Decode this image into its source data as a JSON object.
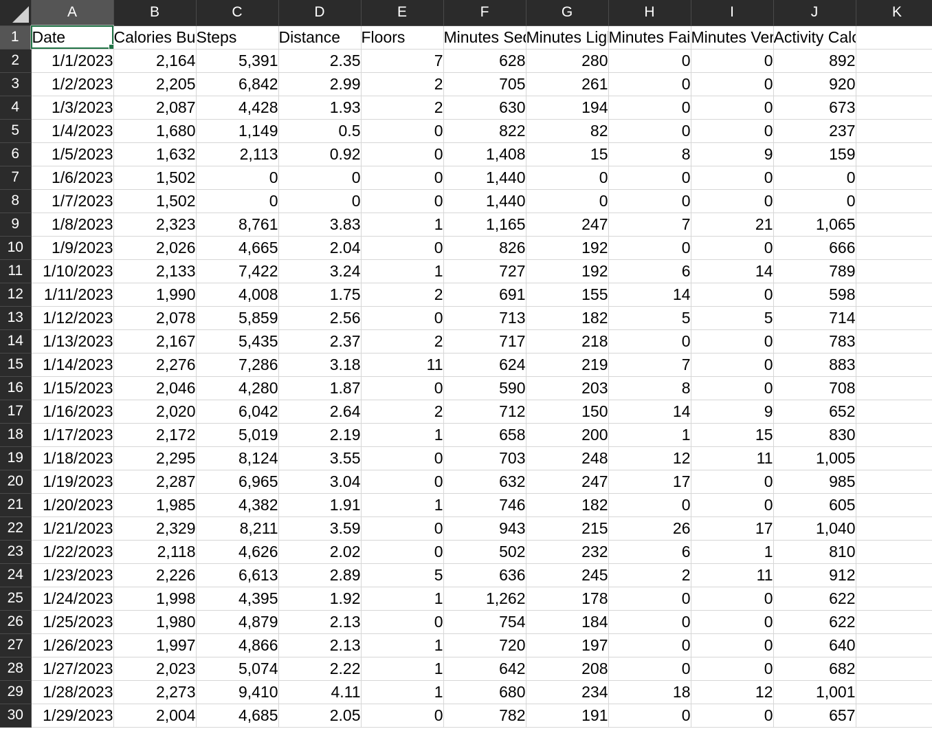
{
  "columns": [
    "A",
    "B",
    "C",
    "D",
    "E",
    "F",
    "G",
    "H",
    "I",
    "J",
    "K"
  ],
  "selected_column": "A",
  "selected_row": "1",
  "headers": [
    "Date",
    "Calories Burned",
    "Steps",
    "Distance",
    "Floors",
    "Minutes Sedentary",
    "Minutes Lightly Active",
    "Minutes Fairly Active",
    "Minutes Very Active",
    "Activity Calories",
    ""
  ],
  "rows": [
    {
      "n": "1",
      "cells": [
        "Date",
        "Calories Burned",
        "Steps",
        "Distance",
        "Floors",
        "Minutes Sedentary",
        "Minutes Lightly Active",
        "Minutes Fairly Active",
        "Minutes Very Active",
        "Activity Calories",
        ""
      ]
    },
    {
      "n": "2",
      "cells": [
        "1/1/2023",
        "2,164",
        "5,391",
        "2.35",
        "7",
        "628",
        "280",
        "0",
        "0",
        "892",
        ""
      ]
    },
    {
      "n": "3",
      "cells": [
        "1/2/2023",
        "2,205",
        "6,842",
        "2.99",
        "2",
        "705",
        "261",
        "0",
        "0",
        "920",
        ""
      ]
    },
    {
      "n": "4",
      "cells": [
        "1/3/2023",
        "2,087",
        "4,428",
        "1.93",
        "2",
        "630",
        "194",
        "0",
        "0",
        "673",
        ""
      ]
    },
    {
      "n": "5",
      "cells": [
        "1/4/2023",
        "1,680",
        "1,149",
        "0.5",
        "0",
        "822",
        "82",
        "0",
        "0",
        "237",
        ""
      ]
    },
    {
      "n": "6",
      "cells": [
        "1/5/2023",
        "1,632",
        "2,113",
        "0.92",
        "0",
        "1,408",
        "15",
        "8",
        "9",
        "159",
        ""
      ]
    },
    {
      "n": "7",
      "cells": [
        "1/6/2023",
        "1,502",
        "0",
        "0",
        "0",
        "1,440",
        "0",
        "0",
        "0",
        "0",
        ""
      ]
    },
    {
      "n": "8",
      "cells": [
        "1/7/2023",
        "1,502",
        "0",
        "0",
        "0",
        "1,440",
        "0",
        "0",
        "0",
        "0",
        ""
      ]
    },
    {
      "n": "9",
      "cells": [
        "1/8/2023",
        "2,323",
        "8,761",
        "3.83",
        "1",
        "1,165",
        "247",
        "7",
        "21",
        "1,065",
        ""
      ]
    },
    {
      "n": "10",
      "cells": [
        "1/9/2023",
        "2,026",
        "4,665",
        "2.04",
        "0",
        "826",
        "192",
        "0",
        "0",
        "666",
        ""
      ]
    },
    {
      "n": "11",
      "cells": [
        "1/10/2023",
        "2,133",
        "7,422",
        "3.24",
        "1",
        "727",
        "192",
        "6",
        "14",
        "789",
        ""
      ]
    },
    {
      "n": "12",
      "cells": [
        "1/11/2023",
        "1,990",
        "4,008",
        "1.75",
        "2",
        "691",
        "155",
        "14",
        "0",
        "598",
        ""
      ]
    },
    {
      "n": "13",
      "cells": [
        "1/12/2023",
        "2,078",
        "5,859",
        "2.56",
        "0",
        "713",
        "182",
        "5",
        "5",
        "714",
        ""
      ]
    },
    {
      "n": "14",
      "cells": [
        "1/13/2023",
        "2,167",
        "5,435",
        "2.37",
        "2",
        "717",
        "218",
        "0",
        "0",
        "783",
        ""
      ]
    },
    {
      "n": "15",
      "cells": [
        "1/14/2023",
        "2,276",
        "7,286",
        "3.18",
        "11",
        "624",
        "219",
        "7",
        "0",
        "883",
        ""
      ]
    },
    {
      "n": "16",
      "cells": [
        "1/15/2023",
        "2,046",
        "4,280",
        "1.87",
        "0",
        "590",
        "203",
        "8",
        "0",
        "708",
        ""
      ]
    },
    {
      "n": "17",
      "cells": [
        "1/16/2023",
        "2,020",
        "6,042",
        "2.64",
        "2",
        "712",
        "150",
        "14",
        "9",
        "652",
        ""
      ]
    },
    {
      "n": "18",
      "cells": [
        "1/17/2023",
        "2,172",
        "5,019",
        "2.19",
        "1",
        "658",
        "200",
        "1",
        "15",
        "830",
        ""
      ]
    },
    {
      "n": "19",
      "cells": [
        "1/18/2023",
        "2,295",
        "8,124",
        "3.55",
        "0",
        "703",
        "248",
        "12",
        "11",
        "1,005",
        ""
      ]
    },
    {
      "n": "20",
      "cells": [
        "1/19/2023",
        "2,287",
        "6,965",
        "3.04",
        "0",
        "632",
        "247",
        "17",
        "0",
        "985",
        ""
      ]
    },
    {
      "n": "21",
      "cells": [
        "1/20/2023",
        "1,985",
        "4,382",
        "1.91",
        "1",
        "746",
        "182",
        "0",
        "0",
        "605",
        ""
      ]
    },
    {
      "n": "22",
      "cells": [
        "1/21/2023",
        "2,329",
        "8,211",
        "3.59",
        "0",
        "943",
        "215",
        "26",
        "17",
        "1,040",
        ""
      ]
    },
    {
      "n": "23",
      "cells": [
        "1/22/2023",
        "2,118",
        "4,626",
        "2.02",
        "0",
        "502",
        "232",
        "6",
        "1",
        "810",
        ""
      ]
    },
    {
      "n": "24",
      "cells": [
        "1/23/2023",
        "2,226",
        "6,613",
        "2.89",
        "5",
        "636",
        "245",
        "2",
        "11",
        "912",
        ""
      ]
    },
    {
      "n": "25",
      "cells": [
        "1/24/2023",
        "1,998",
        "4,395",
        "1.92",
        "1",
        "1,262",
        "178",
        "0",
        "0",
        "622",
        ""
      ]
    },
    {
      "n": "26",
      "cells": [
        "1/25/2023",
        "1,980",
        "4,879",
        "2.13",
        "0",
        "754",
        "184",
        "0",
        "0",
        "622",
        ""
      ]
    },
    {
      "n": "27",
      "cells": [
        "1/26/2023",
        "1,997",
        "4,866",
        "2.13",
        "1",
        "720",
        "197",
        "0",
        "0",
        "640",
        ""
      ]
    },
    {
      "n": "28",
      "cells": [
        "1/27/2023",
        "2,023",
        "5,074",
        "2.22",
        "1",
        "642",
        "208",
        "0",
        "0",
        "682",
        ""
      ]
    },
    {
      "n": "29",
      "cells": [
        "1/28/2023",
        "2,273",
        "9,410",
        "4.11",
        "1",
        "680",
        "234",
        "18",
        "12",
        "1,001",
        ""
      ]
    },
    {
      "n": "30",
      "cells": [
        "1/29/2023",
        "2,004",
        "4,685",
        "2.05",
        "0",
        "782",
        "191",
        "0",
        "0",
        "657",
        ""
      ]
    }
  ]
}
